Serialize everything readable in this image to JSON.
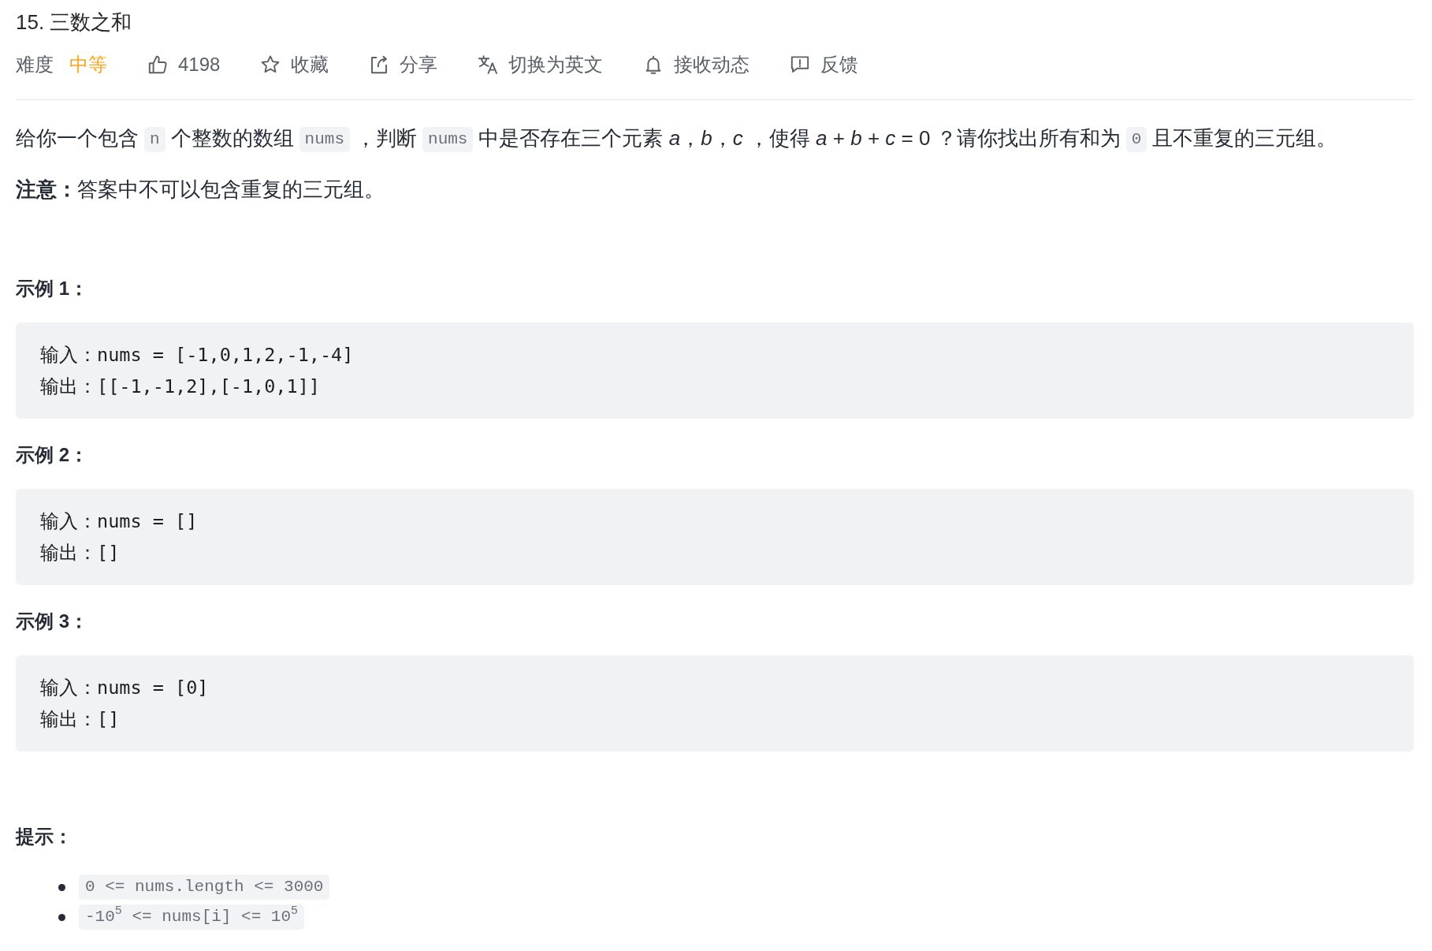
{
  "problem": {
    "title": "15. 三数之和"
  },
  "toolbar": {
    "difficulty_label": "难度",
    "difficulty": "中等",
    "actions": [
      {
        "kind": "like",
        "label": "4198"
      },
      {
        "kind": "favorite",
        "label": "收藏"
      },
      {
        "kind": "share",
        "label": "分享"
      },
      {
        "kind": "translate",
        "label": "切换为英文"
      },
      {
        "kind": "subscribe",
        "label": "接收动态"
      },
      {
        "kind": "feedback",
        "label": "反馈"
      }
    ]
  },
  "description": [
    {
      "kind": "text",
      "text": "给你一个包含"
    },
    {
      "kind": "code",
      "text": "n"
    },
    {
      "kind": "text",
      "text": "个整数的数组"
    },
    {
      "kind": "code",
      "text": "nums"
    },
    {
      "kind": "text",
      "text": "，判断"
    },
    {
      "kind": "code",
      "text": "nums"
    },
    {
      "kind": "text",
      "text": "中是否存在三个元素 *a*，*b*，*c* ，使得 *a* + *b* + *c* = 0 ？请你找出所有和为"
    },
    {
      "kind": "code",
      "text": "0"
    },
    {
      "kind": "text",
      "text": "且不重复的三元组。"
    }
  ],
  "note": "**注意：**答案中不可以包含重复的三元组。",
  "examples": [
    {
      "title": "示例 1：",
      "lines": [
        "输入：nums = [-1,0,1,2,-1,-4]",
        "输出：[[-1,-1,2],[-1,0,1]]"
      ]
    },
    {
      "title": "示例 2：",
      "lines": [
        "输入：nums = []",
        "输出：[]"
      ]
    },
    {
      "title": "示例 3：",
      "lines": [
        "输入：nums = [0]",
        "输出：[]"
      ]
    }
  ],
  "hints": {
    "title": "提示：",
    "items": [
      "0 <= nums.length <= 3000",
      "-10$^{5}$ <= nums[i] <= 10$^{5}$"
    ]
  }
}
